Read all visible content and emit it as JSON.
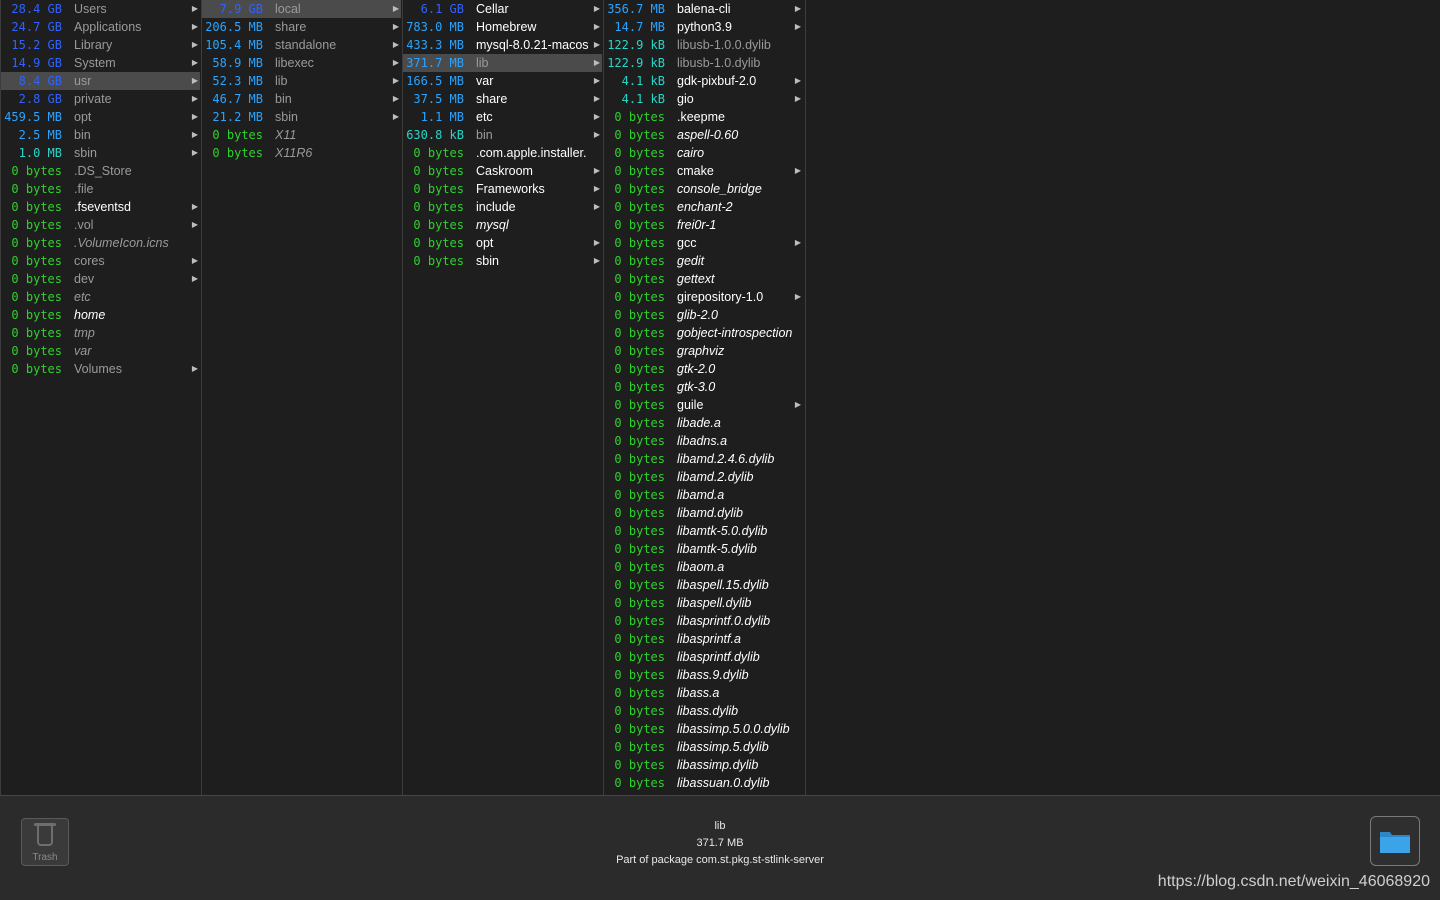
{
  "columns": [
    {
      "id": "root",
      "items": [
        {
          "size": "28.4 GB",
          "unit": "gb",
          "name": "Users",
          "style": "dim",
          "arrow": true
        },
        {
          "size": "24.7 GB",
          "unit": "gb",
          "name": "Applications",
          "style": "dim",
          "arrow": true
        },
        {
          "size": "15.2 GB",
          "unit": "gb",
          "name": "Library",
          "style": "dim",
          "arrow": true
        },
        {
          "size": "14.9 GB",
          "unit": "gb",
          "name": "System",
          "style": "dim",
          "arrow": true
        },
        {
          "size": "8.4 GB",
          "unit": "gb",
          "name": "usr",
          "style": "dim",
          "arrow": true,
          "selected": true
        },
        {
          "size": "2.8 GB",
          "unit": "gb",
          "name": "private",
          "style": "dim",
          "arrow": true
        },
        {
          "size": "459.5 MB",
          "unit": "mb",
          "name": "opt",
          "style": "dim",
          "arrow": true
        },
        {
          "size": "2.5 MB",
          "unit": "mb",
          "name": "bin",
          "style": "dim",
          "arrow": true
        },
        {
          "size": "1.0 MB",
          "unit": "kb",
          "name": "sbin",
          "style": "dim",
          "arrow": true
        },
        {
          "size": "0 bytes",
          "unit": "zero",
          "name": ".DS_Store",
          "style": "dim",
          "arrow": false
        },
        {
          "size": "0 bytes",
          "unit": "zero",
          "name": ".file",
          "style": "dim",
          "arrow": false
        },
        {
          "size": "0 bytes",
          "unit": "zero",
          "name": ".fseventsd",
          "style": "bright",
          "arrow": true
        },
        {
          "size": "0 bytes",
          "unit": "zero",
          "name": ".vol",
          "style": "dim",
          "arrow": true
        },
        {
          "size": "0 bytes",
          "unit": "zero",
          "name": ".VolumeIcon.icns",
          "style": "dim-italic",
          "arrow": false
        },
        {
          "size": "0 bytes",
          "unit": "zero",
          "name": "cores",
          "style": "dim",
          "arrow": true
        },
        {
          "size": "0 bytes",
          "unit": "zero",
          "name": "dev",
          "style": "dim",
          "arrow": true
        },
        {
          "size": "0 bytes",
          "unit": "zero",
          "name": "etc",
          "style": "dim-italic",
          "arrow": false
        },
        {
          "size": "0 bytes",
          "unit": "zero",
          "name": "home",
          "style": "bright-italic",
          "arrow": false
        },
        {
          "size": "0 bytes",
          "unit": "zero",
          "name": "tmp",
          "style": "dim-italic",
          "arrow": false
        },
        {
          "size": "0 bytes",
          "unit": "zero",
          "name": "var",
          "style": "dim-italic",
          "arrow": false
        },
        {
          "size": "0 bytes",
          "unit": "zero",
          "name": "Volumes",
          "style": "dim",
          "arrow": true
        }
      ]
    },
    {
      "id": "usr",
      "items": [
        {
          "size": "7.9 GB",
          "unit": "gb",
          "name": "local",
          "style": "dim",
          "arrow": true,
          "selected": true
        },
        {
          "size": "206.5 MB",
          "unit": "mb",
          "name": "share",
          "style": "dim",
          "arrow": true
        },
        {
          "size": "105.4 MB",
          "unit": "mb",
          "name": "standalone",
          "style": "dim",
          "arrow": true
        },
        {
          "size": "58.9 MB",
          "unit": "mb",
          "name": "libexec",
          "style": "dim",
          "arrow": true
        },
        {
          "size": "52.3 MB",
          "unit": "mb",
          "name": "lib",
          "style": "dim",
          "arrow": true
        },
        {
          "size": "46.7 MB",
          "unit": "mb",
          "name": "bin",
          "style": "dim",
          "arrow": true
        },
        {
          "size": "21.2 MB",
          "unit": "mb",
          "name": "sbin",
          "style": "dim",
          "arrow": true
        },
        {
          "size": "0 bytes",
          "unit": "zero",
          "name": "X11",
          "style": "dim-italic",
          "arrow": false
        },
        {
          "size": "0 bytes",
          "unit": "zero",
          "name": "X11R6",
          "style": "dim-italic",
          "arrow": false
        }
      ]
    },
    {
      "id": "local",
      "items": [
        {
          "size": "6.1 GB",
          "unit": "gb",
          "name": "Cellar",
          "style": "bright",
          "arrow": true
        },
        {
          "size": "783.0 MB",
          "unit": "mb",
          "name": "Homebrew",
          "style": "bright",
          "arrow": true
        },
        {
          "size": "433.3 MB",
          "unit": "mb",
          "name": "mysql-8.0.21-macos",
          "style": "bright",
          "arrow": true
        },
        {
          "size": "371.7 MB",
          "unit": "mb",
          "name": "lib",
          "style": "dim",
          "arrow": true,
          "selected": true
        },
        {
          "size": "166.5 MB",
          "unit": "mb",
          "name": "var",
          "style": "bright",
          "arrow": true
        },
        {
          "size": "37.5 MB",
          "unit": "mb",
          "name": "share",
          "style": "bright",
          "arrow": true
        },
        {
          "size": "1.1 MB",
          "unit": "mb",
          "name": "etc",
          "style": "bright",
          "arrow": true
        },
        {
          "size": "630.8 kB",
          "unit": "kb",
          "name": "bin",
          "style": "dim",
          "arrow": true
        },
        {
          "size": "0 bytes",
          "unit": "zero",
          "name": ".com.apple.installer.",
          "style": "bright",
          "arrow": false
        },
        {
          "size": "0 bytes",
          "unit": "zero",
          "name": "Caskroom",
          "style": "bright",
          "arrow": true
        },
        {
          "size": "0 bytes",
          "unit": "zero",
          "name": "Frameworks",
          "style": "bright",
          "arrow": true
        },
        {
          "size": "0 bytes",
          "unit": "zero",
          "name": "include",
          "style": "bright",
          "arrow": true
        },
        {
          "size": "0 bytes",
          "unit": "zero",
          "name": "mysql",
          "style": "bright-italic",
          "arrow": false
        },
        {
          "size": "0 bytes",
          "unit": "zero",
          "name": "opt",
          "style": "bright",
          "arrow": true
        },
        {
          "size": "0 bytes",
          "unit": "zero",
          "name": "sbin",
          "style": "bright",
          "arrow": true
        }
      ]
    },
    {
      "id": "lib",
      "items": [
        {
          "size": "356.7 MB",
          "unit": "mb",
          "name": "balena-cli",
          "style": "bright",
          "arrow": true
        },
        {
          "size": "14.7 MB",
          "unit": "mb",
          "name": "python3.9",
          "style": "bright",
          "arrow": true
        },
        {
          "size": "122.9 kB",
          "unit": "kb",
          "name": "libusb-1.0.0.dylib",
          "style": "dim",
          "arrow": false
        },
        {
          "size": "122.9 kB",
          "unit": "kb",
          "name": "libusb-1.0.dylib",
          "style": "dim",
          "arrow": false
        },
        {
          "size": "4.1 kB",
          "unit": "kb",
          "name": "gdk-pixbuf-2.0",
          "style": "bright",
          "arrow": true
        },
        {
          "size": "4.1 kB",
          "unit": "kb",
          "name": "gio",
          "style": "bright",
          "arrow": true
        },
        {
          "size": "0 bytes",
          "unit": "zero",
          "name": ".keepme",
          "style": "bright",
          "arrow": false
        },
        {
          "size": "0 bytes",
          "unit": "zero",
          "name": "aspell-0.60",
          "style": "bright-italic",
          "arrow": false
        },
        {
          "size": "0 bytes",
          "unit": "zero",
          "name": "cairo",
          "style": "bright-italic",
          "arrow": false
        },
        {
          "size": "0 bytes",
          "unit": "zero",
          "name": "cmake",
          "style": "bright",
          "arrow": true
        },
        {
          "size": "0 bytes",
          "unit": "zero",
          "name": "console_bridge",
          "style": "bright-italic",
          "arrow": false
        },
        {
          "size": "0 bytes",
          "unit": "zero",
          "name": "enchant-2",
          "style": "bright-italic",
          "arrow": false
        },
        {
          "size": "0 bytes",
          "unit": "zero",
          "name": "frei0r-1",
          "style": "bright-italic",
          "arrow": false
        },
        {
          "size": "0 bytes",
          "unit": "zero",
          "name": "gcc",
          "style": "bright",
          "arrow": true
        },
        {
          "size": "0 bytes",
          "unit": "zero",
          "name": "gedit",
          "style": "bright-italic",
          "arrow": false
        },
        {
          "size": "0 bytes",
          "unit": "zero",
          "name": "gettext",
          "style": "bright-italic",
          "arrow": false
        },
        {
          "size": "0 bytes",
          "unit": "zero",
          "name": "girepository-1.0",
          "style": "bright",
          "arrow": true
        },
        {
          "size": "0 bytes",
          "unit": "zero",
          "name": "glib-2.0",
          "style": "bright-italic",
          "arrow": false
        },
        {
          "size": "0 bytes",
          "unit": "zero",
          "name": "gobject-introspection",
          "style": "bright-italic",
          "arrow": false
        },
        {
          "size": "0 bytes",
          "unit": "zero",
          "name": "graphviz",
          "style": "bright-italic",
          "arrow": false
        },
        {
          "size": "0 bytes",
          "unit": "zero",
          "name": "gtk-2.0",
          "style": "bright-italic",
          "arrow": false
        },
        {
          "size": "0 bytes",
          "unit": "zero",
          "name": "gtk-3.0",
          "style": "bright-italic",
          "arrow": false
        },
        {
          "size": "0 bytes",
          "unit": "zero",
          "name": "guile",
          "style": "bright",
          "arrow": true
        },
        {
          "size": "0 bytes",
          "unit": "zero",
          "name": "libade.a",
          "style": "bright-italic",
          "arrow": false
        },
        {
          "size": "0 bytes",
          "unit": "zero",
          "name": "libadns.a",
          "style": "bright-italic",
          "arrow": false
        },
        {
          "size": "0 bytes",
          "unit": "zero",
          "name": "libamd.2.4.6.dylib",
          "style": "bright-italic",
          "arrow": false
        },
        {
          "size": "0 bytes",
          "unit": "zero",
          "name": "libamd.2.dylib",
          "style": "bright-italic",
          "arrow": false
        },
        {
          "size": "0 bytes",
          "unit": "zero",
          "name": "libamd.a",
          "style": "bright-italic",
          "arrow": false
        },
        {
          "size": "0 bytes",
          "unit": "zero",
          "name": "libamd.dylib",
          "style": "bright-italic",
          "arrow": false
        },
        {
          "size": "0 bytes",
          "unit": "zero",
          "name": "libamtk-5.0.dylib",
          "style": "bright-italic",
          "arrow": false
        },
        {
          "size": "0 bytes",
          "unit": "zero",
          "name": "libamtk-5.dylib",
          "style": "bright-italic",
          "arrow": false
        },
        {
          "size": "0 bytes",
          "unit": "zero",
          "name": "libaom.a",
          "style": "bright-italic",
          "arrow": false
        },
        {
          "size": "0 bytes",
          "unit": "zero",
          "name": "libaspell.15.dylib",
          "style": "bright-italic",
          "arrow": false
        },
        {
          "size": "0 bytes",
          "unit": "zero",
          "name": "libaspell.dylib",
          "style": "bright-italic",
          "arrow": false
        },
        {
          "size": "0 bytes",
          "unit": "zero",
          "name": "libasprintf.0.dylib",
          "style": "bright-italic",
          "arrow": false
        },
        {
          "size": "0 bytes",
          "unit": "zero",
          "name": "libasprintf.a",
          "style": "bright-italic",
          "arrow": false
        },
        {
          "size": "0 bytes",
          "unit": "zero",
          "name": "libasprintf.dylib",
          "style": "bright-italic",
          "arrow": false
        },
        {
          "size": "0 bytes",
          "unit": "zero",
          "name": "libass.9.dylib",
          "style": "bright-italic",
          "arrow": false
        },
        {
          "size": "0 bytes",
          "unit": "zero",
          "name": "libass.a",
          "style": "bright-italic",
          "arrow": false
        },
        {
          "size": "0 bytes",
          "unit": "zero",
          "name": "libass.dylib",
          "style": "bright-italic",
          "arrow": false
        },
        {
          "size": "0 bytes",
          "unit": "zero",
          "name": "libassimp.5.0.0.dylib",
          "style": "bright-italic",
          "arrow": false
        },
        {
          "size": "0 bytes",
          "unit": "zero",
          "name": "libassimp.5.dylib",
          "style": "bright-italic",
          "arrow": false
        },
        {
          "size": "0 bytes",
          "unit": "zero",
          "name": "libassimp.dylib",
          "style": "bright-italic",
          "arrow": false
        },
        {
          "size": "0 bytes",
          "unit": "zero",
          "name": "libassuan.0.dylib",
          "style": "bright-italic",
          "arrow": false
        }
      ]
    }
  ],
  "footer": {
    "trash_label": "Trash",
    "info_name": "lib",
    "info_size": "371.7 MB",
    "info_package": "Part of package com.st.pkg.st-stlink-server",
    "folder_icon": "folder-icon"
  },
  "watermark": "https://blog.csdn.net/weixin_46068920",
  "colors": {
    "gb": "#2f63ff",
    "mb": "#2aa4ff",
    "kb": "#28d6c8",
    "zero": "#2fd12f",
    "selection": "#4b4b4b",
    "folder": "#3ba3e8"
  }
}
